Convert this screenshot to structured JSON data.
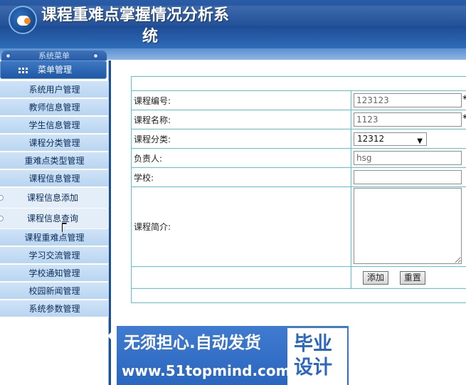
{
  "header": {
    "title_line1": "课程重难点掌握情况分析系",
    "title_line2": "统"
  },
  "menu_tab": {
    "label": "系统菜单"
  },
  "sidebar": {
    "header_label": "菜单管理",
    "items": [
      {
        "label": "系统用户管理"
      },
      {
        "label": "教师信息管理"
      },
      {
        "label": "学生信息管理"
      },
      {
        "label": "课程分类管理"
      },
      {
        "label": "重难点类型管理"
      },
      {
        "label": "课程信息管理"
      },
      {
        "label": "课程信息添加",
        "sub": true
      },
      {
        "label": "课程信息查询",
        "sub": true
      },
      {
        "label": "课程重难点管理"
      },
      {
        "label": "学习交流管理"
      },
      {
        "label": "学校通知管理"
      },
      {
        "label": "校园新闻管理"
      },
      {
        "label": "系统参数管理"
      }
    ]
  },
  "form": {
    "course_no": {
      "label": "课程编号:",
      "value": "123123",
      "required": "*"
    },
    "course_name": {
      "label": "课程名称:",
      "value": "1123",
      "required": "*"
    },
    "course_category": {
      "label": "课程分类:",
      "selected": "12312"
    },
    "owner": {
      "label": "负责人:",
      "value": "hsg"
    },
    "school": {
      "label": "学校:",
      "value": ""
    },
    "intro": {
      "label": "课程简介:",
      "value": ""
    },
    "buttons": {
      "add": "添加",
      "reset": "重置"
    }
  },
  "banner": {
    "line1": "无须担心.自动发货",
    "line2": "www.51topmind.com",
    "box_line1": "毕业",
    "box_line2": "设计"
  },
  "colors": {
    "header_blue": "#1e4d96",
    "menu_item_bg": "#cfe3f7",
    "table_border": "#58c7da",
    "banner_blue": "#2b66bf"
  }
}
